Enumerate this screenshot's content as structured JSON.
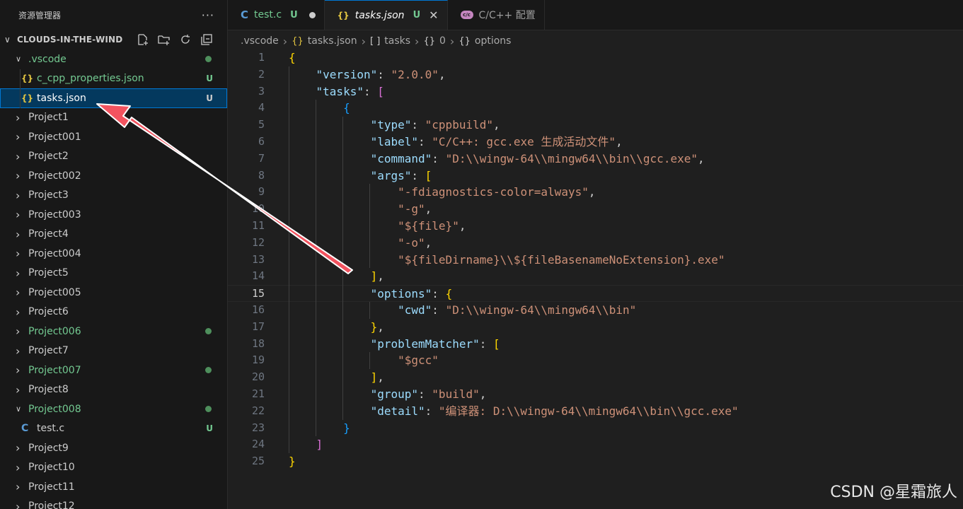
{
  "sidebar": {
    "title": "资源管理器",
    "more": "···",
    "folder": "CLOUDS-IN-THE-WIND",
    "tree": [
      {
        "label": ".vscode",
        "level": 0,
        "chev": "open",
        "kind": "folder",
        "git": true,
        "dot": true
      },
      {
        "label": "c_cpp_properties.json",
        "level": 1,
        "icon": "json",
        "untracked": true,
        "badge": "U"
      },
      {
        "label": "tasks.json",
        "level": 1,
        "icon": "json",
        "selected": true,
        "badge": "U"
      },
      {
        "label": "Project1",
        "level": 0,
        "chev": "closed"
      },
      {
        "label": "Project001",
        "level": 0,
        "chev": "closed"
      },
      {
        "label": "Project2",
        "level": 0,
        "chev": "closed"
      },
      {
        "label": "Project002",
        "level": 0,
        "chev": "closed"
      },
      {
        "label": "Project3",
        "level": 0,
        "chev": "closed"
      },
      {
        "label": "Project003",
        "level": 0,
        "chev": "closed"
      },
      {
        "label": "Project4",
        "level": 0,
        "chev": "closed"
      },
      {
        "label": "Project004",
        "level": 0,
        "chev": "closed"
      },
      {
        "label": "Project5",
        "level": 0,
        "chev": "closed"
      },
      {
        "label": "Project005",
        "level": 0,
        "chev": "closed"
      },
      {
        "label": "Project6",
        "level": 0,
        "chev": "closed"
      },
      {
        "label": "Project006",
        "level": 0,
        "chev": "closed",
        "git": true,
        "dot": true
      },
      {
        "label": "Project7",
        "level": 0,
        "chev": "closed"
      },
      {
        "label": "Project007",
        "level": 0,
        "chev": "closed",
        "git": true,
        "dot": true
      },
      {
        "label": "Project8",
        "level": 0,
        "chev": "closed"
      },
      {
        "label": "Project008",
        "level": 0,
        "chev": "open",
        "git": true,
        "dot": true
      },
      {
        "label": "test.c",
        "level": 1,
        "icon": "c",
        "badge": "U"
      },
      {
        "label": "Project9",
        "level": 0,
        "chev": "closed"
      },
      {
        "label": "Project10",
        "level": 0,
        "chev": "closed"
      },
      {
        "label": "Project11",
        "level": 0,
        "chev": "closed"
      },
      {
        "label": "Project12",
        "level": 0,
        "chev": "closed"
      }
    ]
  },
  "tabs": [
    {
      "label": "test.c",
      "icon": "c",
      "status": "U",
      "dirty": true,
      "untracked": true
    },
    {
      "label": "tasks.json",
      "icon": "json",
      "status": "U",
      "active": true,
      "italic": true
    },
    {
      "label": "C/C++ 配置",
      "icon": "gear"
    }
  ],
  "breadcrumbs": [
    ".vscode",
    "tasks.json",
    "tasks",
    "0",
    "options"
  ],
  "code": [
    [
      [
        "b1",
        "{"
      ]
    ],
    [
      [
        "sp",
        "    "
      ],
      [
        "k",
        "\"version\""
      ],
      [
        "p",
        ": "
      ],
      [
        "s",
        "\"2.0.0\""
      ],
      [
        "p",
        ","
      ]
    ],
    [
      [
        "sp",
        "    "
      ],
      [
        "k",
        "\"tasks\""
      ],
      [
        "p",
        ": "
      ],
      [
        "b2",
        "["
      ]
    ],
    [
      [
        "sp",
        "        "
      ],
      [
        "b3",
        "{"
      ]
    ],
    [
      [
        "sp",
        "            "
      ],
      [
        "k",
        "\"type\""
      ],
      [
        "p",
        ": "
      ],
      [
        "s",
        "\"cppbuild\""
      ],
      [
        "p",
        ","
      ]
    ],
    [
      [
        "sp",
        "            "
      ],
      [
        "k",
        "\"label\""
      ],
      [
        "p",
        ": "
      ],
      [
        "s",
        "\"C/C++: gcc.exe 生成活动文件\""
      ],
      [
        "p",
        ","
      ]
    ],
    [
      [
        "sp",
        "            "
      ],
      [
        "k",
        "\"command\""
      ],
      [
        "p",
        ": "
      ],
      [
        "s",
        "\"D:\\\\wingw-64\\\\mingw64\\\\bin\\\\gcc.exe\""
      ],
      [
        "p",
        ","
      ]
    ],
    [
      [
        "sp",
        "            "
      ],
      [
        "k",
        "\"args\""
      ],
      [
        "p",
        ": "
      ],
      [
        "b1",
        "["
      ]
    ],
    [
      [
        "sp",
        "                "
      ],
      [
        "s",
        "\"-fdiagnostics-color=always\""
      ],
      [
        "p",
        ","
      ]
    ],
    [
      [
        "sp",
        "                "
      ],
      [
        "s",
        "\"-g\""
      ],
      [
        "p",
        ","
      ]
    ],
    [
      [
        "sp",
        "                "
      ],
      [
        "s",
        "\"${file}\""
      ],
      [
        "p",
        ","
      ]
    ],
    [
      [
        "sp",
        "                "
      ],
      [
        "s",
        "\"-o\""
      ],
      [
        "p",
        ","
      ]
    ],
    [
      [
        "sp",
        "                "
      ],
      [
        "s",
        "\"${fileDirname}\\\\${fileBasenameNoExtension}.exe\""
      ]
    ],
    [
      [
        "sp",
        "            "
      ],
      [
        "b1",
        "]"
      ],
      [
        "p",
        ","
      ]
    ],
    [
      [
        "sp",
        "            "
      ],
      [
        "k",
        "\"options\""
      ],
      [
        "p",
        ": "
      ],
      [
        "b1",
        "{"
      ]
    ],
    [
      [
        "sp",
        "                "
      ],
      [
        "k",
        "\"cwd\""
      ],
      [
        "p",
        ": "
      ],
      [
        "s",
        "\"D:\\\\wingw-64\\\\mingw64\\\\bin\""
      ]
    ],
    [
      [
        "sp",
        "            "
      ],
      [
        "b1",
        "}"
      ],
      [
        "p",
        ","
      ]
    ],
    [
      [
        "sp",
        "            "
      ],
      [
        "k",
        "\"problemMatcher\""
      ],
      [
        "p",
        ": "
      ],
      [
        "b1",
        "["
      ]
    ],
    [
      [
        "sp",
        "                "
      ],
      [
        "s",
        "\"$gcc\""
      ]
    ],
    [
      [
        "sp",
        "            "
      ],
      [
        "b1",
        "]"
      ],
      [
        "p",
        ","
      ]
    ],
    [
      [
        "sp",
        "            "
      ],
      [
        "k",
        "\"group\""
      ],
      [
        "p",
        ": "
      ],
      [
        "s",
        "\"build\""
      ],
      [
        "p",
        ","
      ]
    ],
    [
      [
        "sp",
        "            "
      ],
      [
        "k",
        "\"detail\""
      ],
      [
        "p",
        ": "
      ],
      [
        "s",
        "\"编译器: D:\\\\wingw-64\\\\mingw64\\\\bin\\\\gcc.exe\""
      ]
    ],
    [
      [
        "sp",
        "        "
      ],
      [
        "b3",
        "}"
      ]
    ],
    [
      [
        "sp",
        "    "
      ],
      [
        "b2",
        "]"
      ]
    ],
    [
      [
        "b1",
        "}"
      ]
    ]
  ],
  "current_line": 15,
  "watermark": "CSDN @星霜旅人",
  "colors": {
    "accent": "#0078d4",
    "git_untracked": "#73c991",
    "annotation_arrow": "#f2535f"
  }
}
